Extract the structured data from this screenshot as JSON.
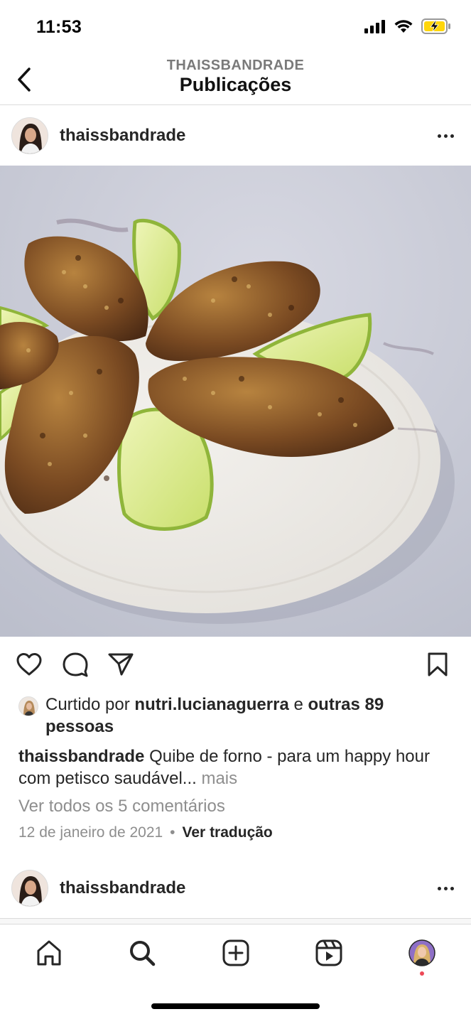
{
  "status_bar": {
    "time": "11:53",
    "icons": [
      "signal-icon",
      "wifi-icon",
      "battery-charging-icon"
    ],
    "battery_color": "#ffd60a"
  },
  "header": {
    "subtitle": "THAISSBANDRADE",
    "title": "Publicações",
    "back_icon": "chevron-left-icon"
  },
  "post": {
    "username": "thaissbandrade",
    "photo_description_icon": "food-photo",
    "actions": [
      "heart-icon",
      "comment-icon",
      "share-icon",
      "bookmark-icon"
    ],
    "likes": {
      "prefix": "Curtido por",
      "liker": "nutri.lucianaguerra",
      "connector": "e",
      "others": "outras 89 pessoas"
    },
    "caption": {
      "author": "thaissbandrade",
      "text": "Quibe de forno - para um happy hour com petisco saudável...",
      "more": "mais"
    },
    "comments_link": "Ver todos os 5 comentários",
    "date": "12 de janeiro de 2021",
    "separator": "•",
    "translate": "Ver tradução"
  },
  "next_post": {
    "username": "thaissbandrade"
  },
  "tab_bar": {
    "tabs": [
      "home-icon",
      "search-icon",
      "new-post-icon",
      "reels-icon",
      "profile-avatar"
    ],
    "notification_color": "#ed4956"
  }
}
